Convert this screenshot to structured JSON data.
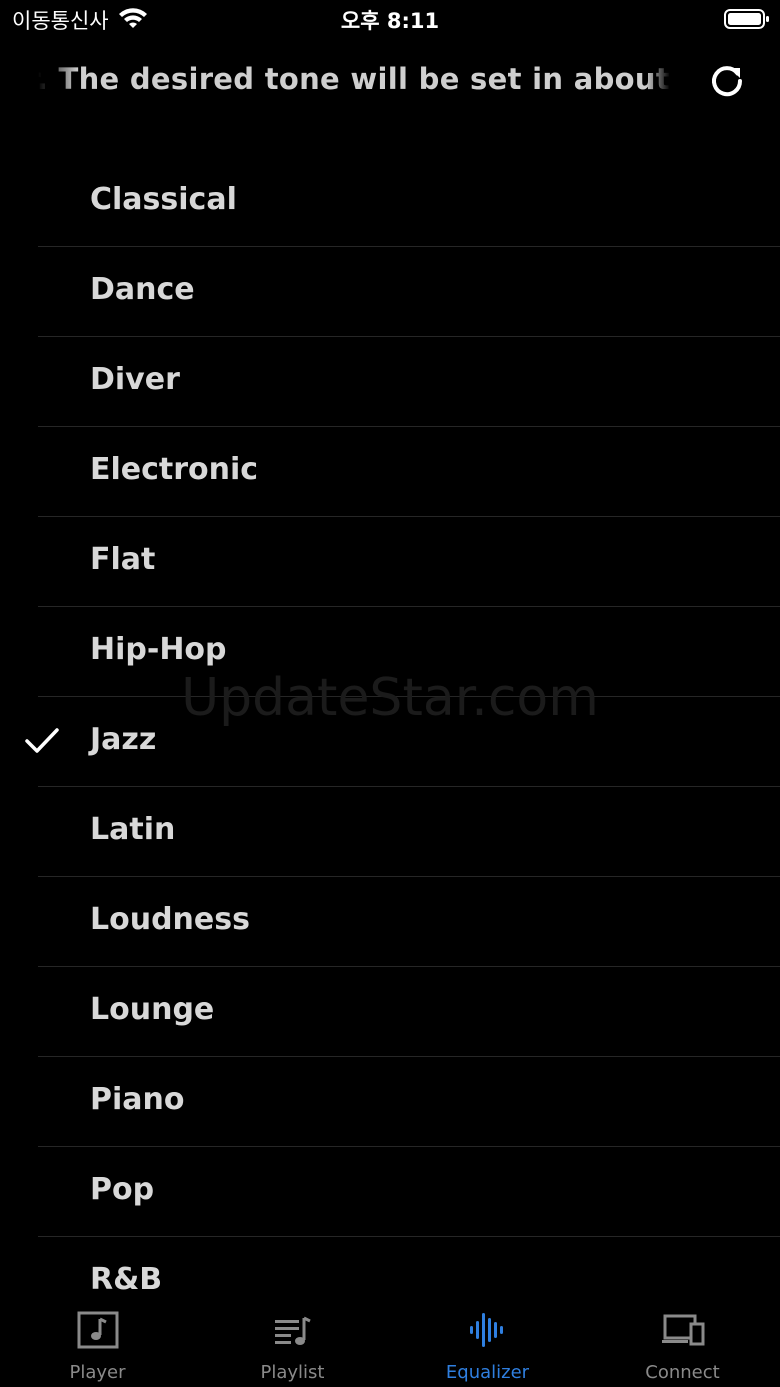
{
  "status_bar": {
    "carrier": "이동통신사",
    "time": "오후 8:11"
  },
  "header": {
    "marquee_text": "ualizer. The desired tone will be set in about"
  },
  "presets": [
    {
      "label": "Classical",
      "selected": false
    },
    {
      "label": "Dance",
      "selected": false
    },
    {
      "label": "Diver",
      "selected": false
    },
    {
      "label": "Electronic",
      "selected": false
    },
    {
      "label": "Flat",
      "selected": false
    },
    {
      "label": "Hip-Hop",
      "selected": false
    },
    {
      "label": "Jazz",
      "selected": true
    },
    {
      "label": "Latin",
      "selected": false
    },
    {
      "label": "Loudness",
      "selected": false
    },
    {
      "label": "Lounge",
      "selected": false
    },
    {
      "label": "Piano",
      "selected": false
    },
    {
      "label": "Pop",
      "selected": false
    },
    {
      "label": "R&B",
      "selected": false
    }
  ],
  "watermark": "UpdateStar.com",
  "tabs": [
    {
      "label": "Player",
      "icon": "music-note-icon",
      "active": false
    },
    {
      "label": "Playlist",
      "icon": "playlist-icon",
      "active": false
    },
    {
      "label": "Equalizer",
      "icon": "waveform-icon",
      "active": true
    },
    {
      "label": "Connect",
      "icon": "devices-icon",
      "active": false
    }
  ],
  "colors": {
    "accent": "#2f7fe0",
    "inactive": "#8a8a8a",
    "background": "#000000"
  }
}
